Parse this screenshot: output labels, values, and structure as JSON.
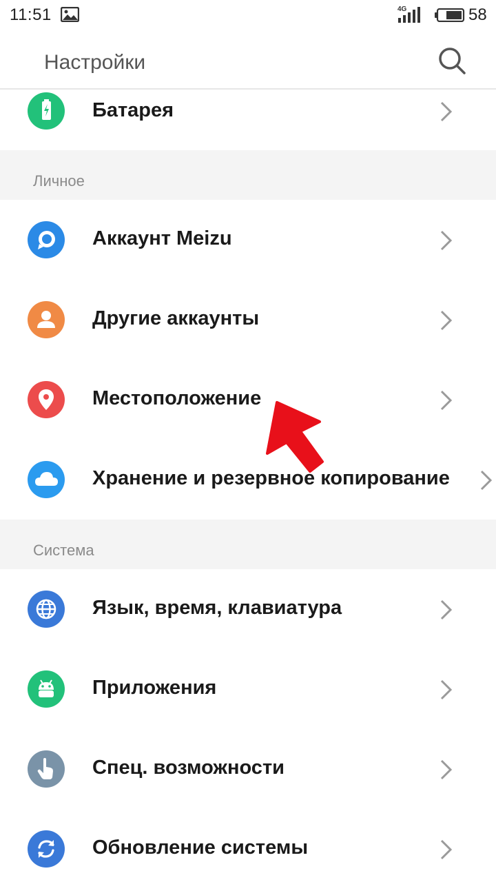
{
  "status_bar": {
    "time": "11:51",
    "network": "4G",
    "battery": "58"
  },
  "app_bar": {
    "title": "Настройки",
    "search_icon": "search-icon"
  },
  "list": {
    "battery": {
      "label": "Батарея",
      "icon": "battery-icon",
      "color": "#22c17a"
    },
    "section_personal": "Личное",
    "meizu_account": {
      "label": "Аккаунт Meizu",
      "icon": "meizu-account-icon",
      "color": "#2b8ae6"
    },
    "other_accounts": {
      "label": "Другие аккаунты",
      "icon": "user-icon",
      "color": "#f08a45"
    },
    "location": {
      "label": "Местоположение",
      "icon": "location-pin-icon",
      "color": "#ec4c4c"
    },
    "backup": {
      "label": "Хранение и резервное копирование",
      "icon": "cloud-icon",
      "color": "#2b9bef"
    },
    "section_system": "Система",
    "language": {
      "label": "Язык, время, клавиатура",
      "icon": "globe-icon",
      "color": "#3a79d8"
    },
    "apps": {
      "label": "Приложения",
      "icon": "android-icon",
      "color": "#22c17a"
    },
    "accessibility": {
      "label": "Спец. возможности",
      "icon": "hand-icon",
      "color": "#7a93a8"
    },
    "update": {
      "label": "Обновление системы",
      "icon": "update-icon",
      "color": "#3a79d8"
    }
  },
  "annotation_color": "#e8101a"
}
